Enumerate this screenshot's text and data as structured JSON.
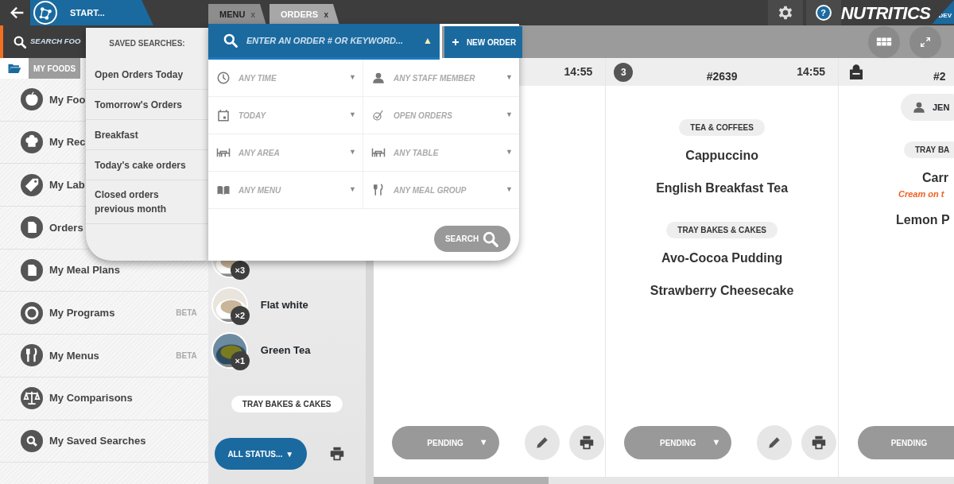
{
  "app_bar": {
    "start_label": "START...",
    "tabs": [
      {
        "label": "MENU",
        "selected": false,
        "close": "x"
      },
      {
        "label": "ORDERS",
        "selected": true,
        "close": "x"
      }
    ],
    "help": "?",
    "brand": "NUTRITICS",
    "brand_badge": "DEV"
  },
  "food_search": {
    "placeholder": "SEARCH FOO"
  },
  "sidebar": {
    "tab": "MY FOODS",
    "items": [
      {
        "label": "My Foo"
      },
      {
        "label": "My Rec"
      },
      {
        "label": "My Lab"
      },
      {
        "label": "Orders"
      },
      {
        "label": "My Meal Plans"
      },
      {
        "label": "My Programs",
        "badge": "BETA"
      },
      {
        "label": "My Menus",
        "badge": "BETA"
      },
      {
        "label": "My Comparisons"
      },
      {
        "label": "My Saved Searches"
      }
    ]
  },
  "saved_searches": {
    "title": "SAVED SEARCHES:",
    "items": [
      {
        "label": "Open Orders Today"
      },
      {
        "label": "Tomorrow's Orders"
      },
      {
        "label": "Breakfast"
      },
      {
        "label": "Today's cake orders"
      },
      {
        "label": "Closed orders previous month"
      }
    ]
  },
  "order_search": {
    "placeholder": "ENTER AN ORDER # OR KEYWORD...",
    "toggle": "▲",
    "new_order": "NEW ORDER",
    "filters": [
      {
        "placeholder": "ANY TIME",
        "caret": "▼"
      },
      {
        "placeholder": "ANY STAFF MEMBER",
        "caret": "▼"
      },
      {
        "placeholder": "TODAY",
        "caret": "▼"
      },
      {
        "placeholder": "OPEN ORDERS",
        "caret": "▼"
      },
      {
        "placeholder": "ANY AREA",
        "caret": "▼"
      },
      {
        "placeholder": "ANY TABLE",
        "caret": "▼"
      },
      {
        "placeholder": "ANY MENU",
        "caret": "▼"
      },
      {
        "placeholder": "ANY MEAL GROUP",
        "caret": "▼"
      }
    ],
    "search_button": "SEARCH"
  },
  "order_list": {
    "items": [
      {
        "count": "×3"
      },
      {
        "name": "Flat white",
        "count": "×2"
      },
      {
        "name": "Green Tea",
        "count": "×1"
      }
    ],
    "section": "TRAY BAKES & CAKES",
    "status_filter": "ALL STATUS...",
    "status_caret": "▼"
  },
  "orders": [
    {
      "kind": "wide",
      "time": "14:55",
      "status": "PENDING",
      "caret": "▼"
    },
    {
      "kind": "wide",
      "badge": "3",
      "number": "#2639",
      "time": "14:55",
      "groups": [
        {
          "title": "TEA & COFFEES",
          "items": [
            {
              "name": "Cappuccino"
            },
            {
              "name": "English Breakfast Tea"
            }
          ]
        },
        {
          "title": "TRAY BAKES & CAKES",
          "items": [
            {
              "name": "Avo-Cocoa Pudding"
            },
            {
              "name": "Strawberry Cheesecake"
            }
          ]
        }
      ],
      "status": "PENDING",
      "caret": "▼"
    },
    {
      "kind": "cut",
      "number": "#2",
      "staff": "JEN",
      "groups": [
        {
          "title": "TRAY BA",
          "items": [
            {
              "name": "Carr",
              "note": "Cream on t"
            },
            {
              "name": "Lemon P"
            }
          ]
        }
      ],
      "status": "PENDING"
    }
  ]
}
